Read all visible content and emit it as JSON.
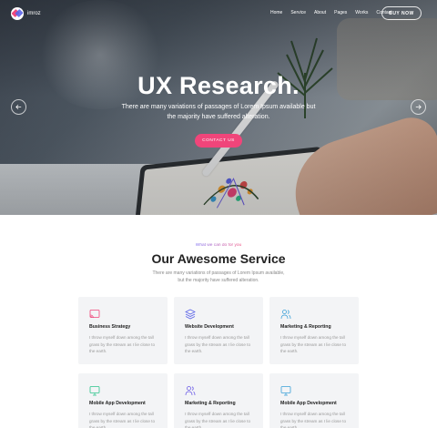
{
  "brand": {
    "name": "imroz"
  },
  "nav": {
    "items": [
      "Home",
      "Service",
      "About",
      "Pages",
      "Works",
      "Contact"
    ],
    "buy_label": "BUY NOW"
  },
  "hero": {
    "title": "UX Research.",
    "subtitle": "There are many variations of passages of Lorem Ipsum available but the majority have suffered alteration.",
    "cta_label": "CONTACT US"
  },
  "services": {
    "eyebrow": "What we can do for you",
    "title": "Our Awesome Service",
    "subtitle": "There are many variations of passages of Lorem Ipsum available, but the majority have suffered alteration.",
    "cards": [
      {
        "title": "Business Strategy",
        "desc": "I throw myself down among the tall grass by the stream as I lie close to the earth.",
        "icon": "cast-icon",
        "color": "#f0457a"
      },
      {
        "title": "Website Development",
        "desc": "I throw myself down among the tall grass by the stream as I lie close to the earth.",
        "icon": "layers-icon",
        "color": "#5b64e8"
      },
      {
        "title": "Marketing & Reporting",
        "desc": "I throw myself down among the tall grass by the stream as I lie close to the earth.",
        "icon": "users-icon",
        "color": "#3aa0d8"
      },
      {
        "title": "Mobile App Development",
        "desc": "I throw myself down among the tall grass by the stream as I lie close to the earth.",
        "icon": "monitor-icon",
        "color": "#2bc48a"
      },
      {
        "title": "Marketing & Reporting",
        "desc": "I throw myself down among the tall grass by the stream as I lie close to the earth.",
        "icon": "users-icon",
        "color": "#6c5ce7"
      },
      {
        "title": "Mobile App Development",
        "desc": "I throw myself down among the tall grass by the stream as I lie close to the earth.",
        "icon": "monitor-icon",
        "color": "#3aa0d8"
      }
    ]
  }
}
